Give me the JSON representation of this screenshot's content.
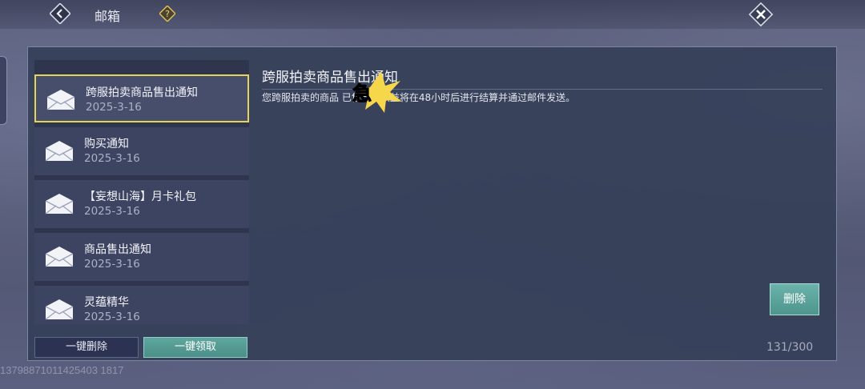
{
  "header": {
    "title": "邮箱"
  },
  "mail_list": [
    {
      "title": "跨服拍卖商品售出通知",
      "date": "2025-3-16",
      "selected": true
    },
    {
      "title": "购买通知",
      "date": "2025-3-16",
      "selected": false
    },
    {
      "title": "【妄想山海】月卡礼包",
      "date": "2025-3-16",
      "selected": false
    },
    {
      "title": "商品售出通知",
      "date": "2025-3-16",
      "selected": false
    },
    {
      "title": "灵蕴精华",
      "date": "2025-3-16",
      "selected": false
    }
  ],
  "detail": {
    "title": "跨服拍卖商品售出通知",
    "body": "您跨服拍卖的商品 已售出，收益将在48小时后进行结算并通过邮件发送。",
    "stamp_text": "急"
  },
  "buttons": {
    "delete": "删除",
    "delete_all": "一键删除",
    "claim_all": "一键领取"
  },
  "mail_count": "131/300",
  "watermark": "13798871011425403 1817",
  "colors": {
    "selected_border": "#e6d35a",
    "accent_teal": "#5fa79e"
  }
}
